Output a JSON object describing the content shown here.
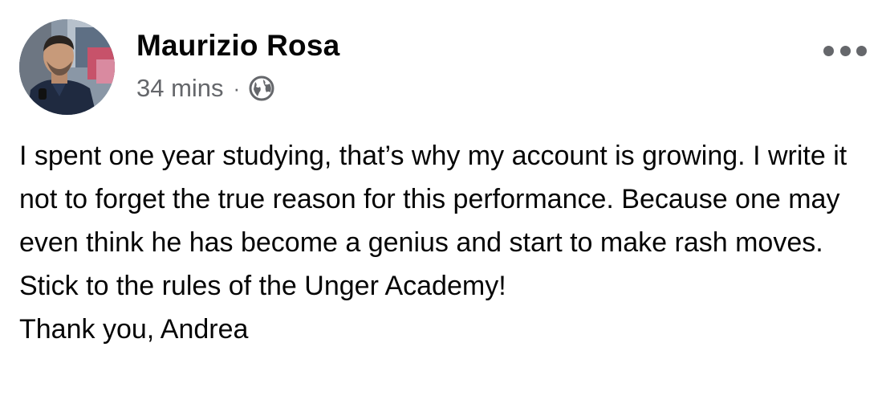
{
  "post": {
    "author": {
      "name": "Maurizio Rosa",
      "avatar_icon": "profile-photo"
    },
    "meta": {
      "time": "34 mins",
      "separator": "·",
      "privacy_icon": "globe-icon"
    },
    "more_icon": "more-options-icon",
    "body": {
      "text": "I spent one year studying, that’s why my account is growing. I write it not to forget the true reason for this performance. Because one may even think he has become a genius and start to make rash moves. Stick to the rules of the Unger Academy!",
      "signoff": "Thank you, Andrea"
    }
  },
  "colors": {
    "primary_text": "#050505",
    "secondary_text": "#65676b",
    "background": "#ffffff"
  }
}
